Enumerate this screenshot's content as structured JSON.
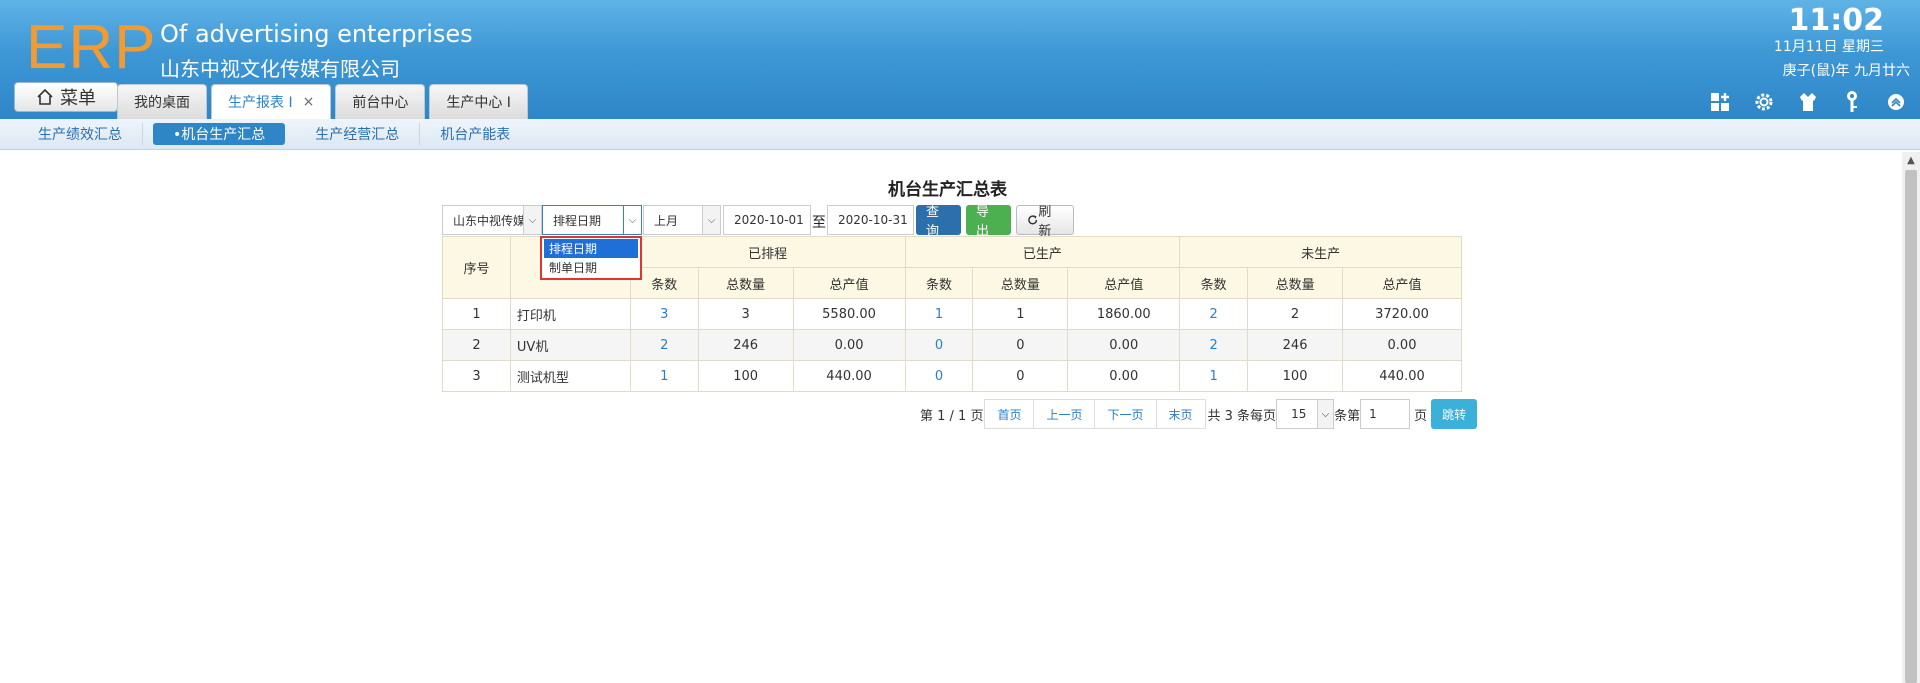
{
  "header": {
    "logo": "ERP",
    "company_en": "Of advertising enterprises",
    "company_cn": "山东中视文化传媒有限公司",
    "time": "11:02",
    "date": "11月11日 星期三",
    "lunar": "庚子(鼠)年 九月廿六",
    "menu_label": "菜单",
    "tabs": [
      {
        "label": "我的桌面"
      },
      {
        "label": "生产报表 I"
      },
      {
        "label": "前台中心"
      },
      {
        "label": "生产中心 I"
      }
    ],
    "tab_close": "×",
    "tool_icons": [
      "grid-add-icon",
      "gear-icon",
      "shirt-icon",
      "key-icon",
      "chevron-up-icon"
    ]
  },
  "subnav": {
    "items": [
      "生产绩效汇总",
      "•机台生产汇总",
      "生产经营汇总",
      "机台产能表"
    ],
    "active_index": 1
  },
  "report": {
    "title": "机台生产汇总表",
    "filters": {
      "company": "山东中视传媒",
      "date_type": "排程日期",
      "period": "上月",
      "start_date": "2020-10-01",
      "to_label": "至",
      "end_date": "2020-10-31"
    },
    "buttons": {
      "query": "查询",
      "export": "导出",
      "refresh": "刷新"
    },
    "dropdown_options": [
      "排程日期",
      "制单日期"
    ],
    "dropdown_selected": 0,
    "columns": {
      "no": "序号",
      "machine": "",
      "groups": [
        "已排程",
        "已生产",
        "未生产"
      ],
      "sub": [
        "条数",
        "总数量",
        "总产值"
      ]
    },
    "rows": [
      {
        "no": "1",
        "name": "打印机",
        "s_cnt": "3",
        "s_qty": "3",
        "s_val": "5580.00",
        "p_cnt": "1",
        "p_qty": "1",
        "p_val": "1860.00",
        "u_cnt": "2",
        "u_qty": "2",
        "u_val": "3720.00"
      },
      {
        "no": "2",
        "name": "UV机",
        "s_cnt": "2",
        "s_qty": "246",
        "s_val": "0.00",
        "p_cnt": "0",
        "p_qty": "0",
        "p_val": "0.00",
        "u_cnt": "2",
        "u_qty": "246",
        "u_val": "0.00"
      },
      {
        "no": "3",
        "name": "测试机型",
        "s_cnt": "1",
        "s_qty": "100",
        "s_val": "440.00",
        "p_cnt": "0",
        "p_qty": "0",
        "p_val": "0.00",
        "u_cnt": "1",
        "u_qty": "100",
        "u_val": "440.00"
      }
    ],
    "pager": {
      "info": "第 1 / 1 页",
      "first": "首页",
      "prev": "上一页",
      "next": "下一页",
      "last": "末页",
      "total": "共 3 条每页",
      "page_size": "15",
      "goto_prefix": "条第",
      "goto_value": "1",
      "goto_suffix": "页",
      "jump": "跳转"
    }
  },
  "colors": {
    "header_blue": "#3d97d5",
    "logo_orange": "#f39a33",
    "link_blue": "#2a7fc4",
    "query_blue": "#2c6fad",
    "export_green": "#4caf50",
    "highlight_red": "#e03535"
  }
}
